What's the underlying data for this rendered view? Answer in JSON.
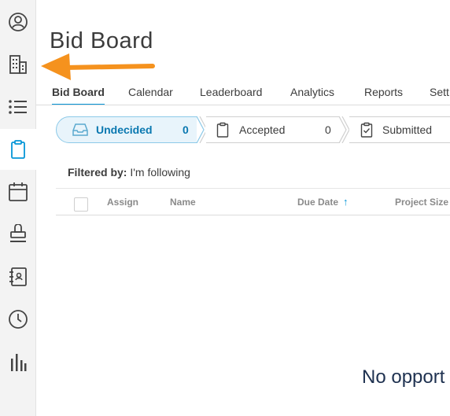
{
  "page": {
    "title": "Bid Board"
  },
  "tabs": [
    {
      "label": "Bid Board",
      "active": true
    },
    {
      "label": "Calendar"
    },
    {
      "label": "Leaderboard"
    },
    {
      "label": "Analytics"
    },
    {
      "label": "Reports"
    },
    {
      "label": "Sett"
    }
  ],
  "stages": [
    {
      "label": "Undecided",
      "count": "0",
      "icon": "inbox-icon",
      "active": true
    },
    {
      "label": "Accepted",
      "count": "0",
      "icon": "clipboard-icon"
    },
    {
      "label": "Submitted",
      "icon": "clipboard-check-icon"
    }
  ],
  "filter": {
    "prefix": "Filtered by:",
    "value": "I'm following"
  },
  "table": {
    "columns": [
      "Assign",
      "Name",
      "Due Date",
      "Project Size"
    ],
    "sort_indicator": "↑"
  },
  "empty_state": "No opport",
  "sidebar": {
    "items": [
      {
        "icon": "user-circle-icon"
      },
      {
        "icon": "building-icon"
      },
      {
        "icon": "list-icon"
      },
      {
        "icon": "clipboard-icon",
        "active": true
      },
      {
        "icon": "calendar-icon"
      },
      {
        "icon": "stamp-icon"
      },
      {
        "icon": "address-book-icon"
      },
      {
        "icon": "clock-icon"
      },
      {
        "icon": "bar-chart-icon"
      }
    ]
  },
  "colors": {
    "accent": "#0696d7",
    "active_stage_bg": "#e8f4fb",
    "annotation_arrow": "#f5921e",
    "empty_text": "#1e3150"
  }
}
